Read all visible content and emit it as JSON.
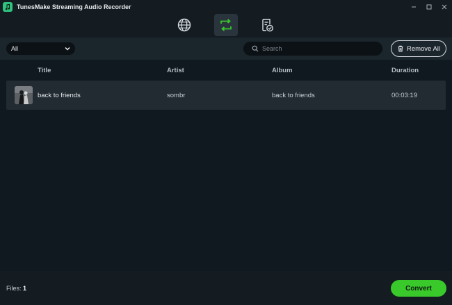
{
  "app": {
    "title": "TunesMake Streaming Audio Recorder",
    "accent": "#39c92b"
  },
  "window_controls": [
    "minimize",
    "maximize",
    "close"
  ],
  "nav": {
    "items": [
      {
        "icon": "globe-icon",
        "active": false
      },
      {
        "icon": "convert-icon",
        "active": true
      },
      {
        "icon": "converted-list-icon",
        "active": false
      }
    ]
  },
  "toolbar": {
    "filter_value": "All",
    "search_placeholder": "Search",
    "remove_all_label": "Remove All"
  },
  "table": {
    "headers": {
      "title": "Title",
      "artist": "Artist",
      "album": "Album",
      "duration": "Duration"
    },
    "rows": [
      {
        "title": "back to friends",
        "artist": "sombr",
        "album": "back to friends",
        "duration": "00:03:19"
      }
    ]
  },
  "footer": {
    "files_label": "Files:",
    "files_count": "1",
    "convert_label": "Convert"
  }
}
